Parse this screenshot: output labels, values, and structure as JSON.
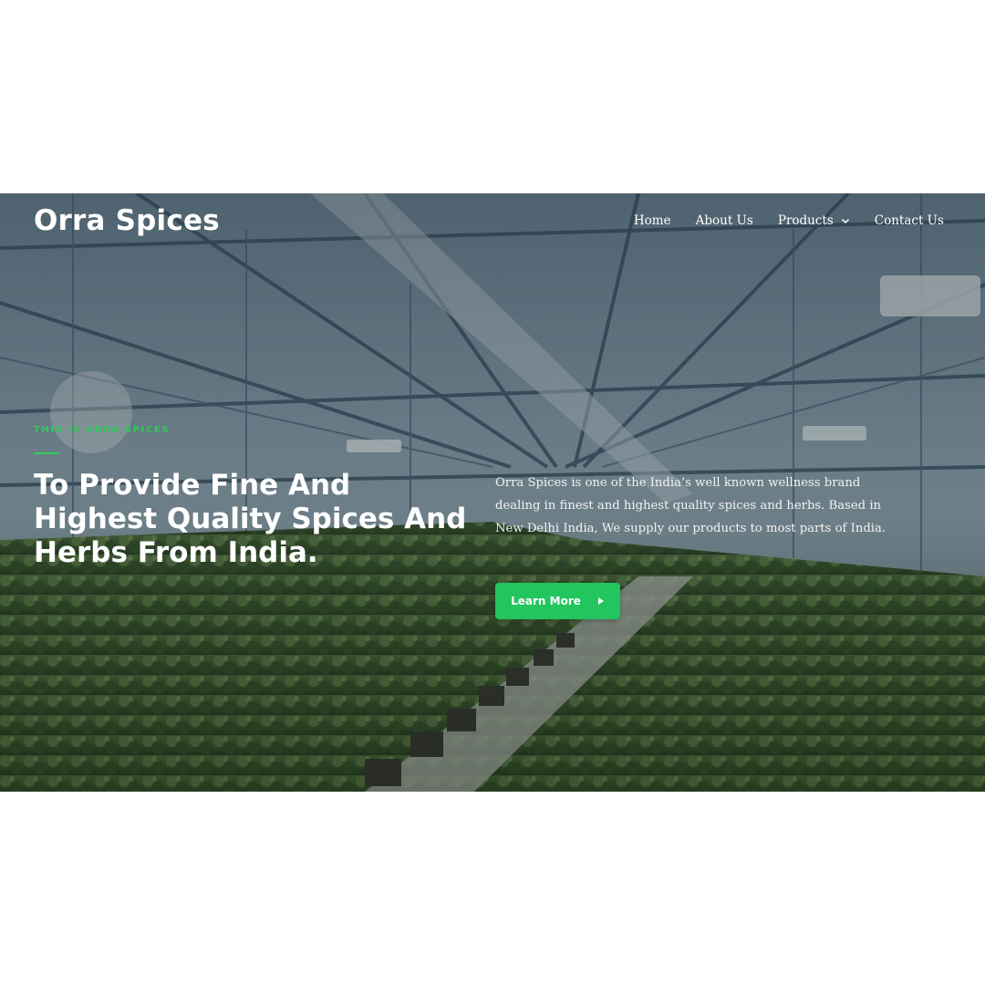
{
  "header": {
    "brand": "Orra Spices",
    "nav": [
      {
        "label": "Home"
      },
      {
        "label": "About Us"
      },
      {
        "label": "Products",
        "icon": "chevron-down-icon"
      },
      {
        "label": "Contact Us"
      }
    ]
  },
  "hero": {
    "eyebrow": "THIS IS ORRA SPICES",
    "headline": "To Provide Fine And Highest Quality Spices And Herbs From India.",
    "description": "Orra Spices is one of the India’s well known wellness brand dealing in finest and highest quality spices and herbs. Based in New Delhi India, We supply our products to most parts of India.",
    "cta_label": "Learn More",
    "cta_icon": "caret-right-icon",
    "background": "greenhouse-photo"
  },
  "colors": {
    "accent": "#22c55e",
    "eyebrow": "#2ecc55",
    "text": "#ffffff"
  }
}
